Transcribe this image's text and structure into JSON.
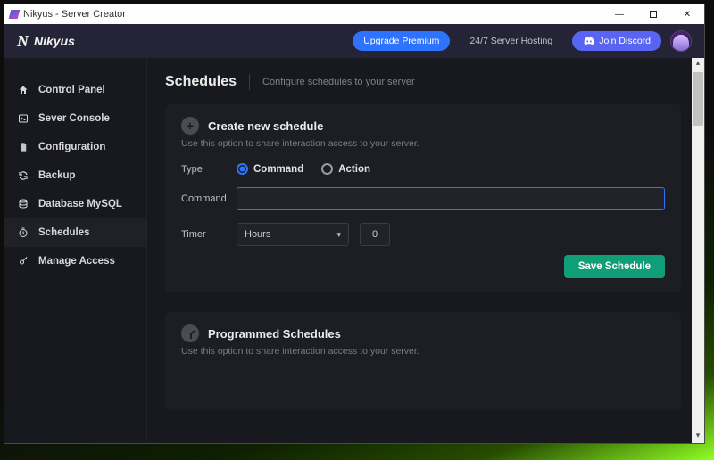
{
  "window": {
    "title": "Nikyus - Server Creator"
  },
  "brand": {
    "name": "Nikyus"
  },
  "header": {
    "upgrade": "Upgrade Premium",
    "hosting": "24/7 Server Hosting",
    "discord": "Join Discord"
  },
  "sidebar": {
    "items": [
      {
        "id": "control-panel",
        "label": "Control Panel",
        "icon": "home-icon"
      },
      {
        "id": "server-console",
        "label": "Sever Console",
        "icon": "console-icon"
      },
      {
        "id": "configuration",
        "label": "Configuration",
        "icon": "file-icon"
      },
      {
        "id": "backup",
        "label": "Backup",
        "icon": "refresh-icon"
      },
      {
        "id": "database",
        "label": "Database MySQL",
        "icon": "database-icon"
      },
      {
        "id": "schedules",
        "label": "Schedules",
        "icon": "clock-icon"
      },
      {
        "id": "manage-access",
        "label": "Manage Access",
        "icon": "key-icon"
      }
    ],
    "active": "schedules"
  },
  "page": {
    "title": "Schedules",
    "subtitle": "Configure schedules to your server"
  },
  "create": {
    "title": "Create new schedule",
    "subtitle": "Use this option to share interaction access to your server.",
    "type_label": "Type",
    "type_options": {
      "command": "Command",
      "action": "Action"
    },
    "type_selected": "command",
    "command_label": "Command",
    "command_value": "",
    "timer_label": "Timer",
    "timer_unit_options": [
      "Hours"
    ],
    "timer_unit_selected": "Hours",
    "timer_value": "0",
    "save_label": "Save Schedule"
  },
  "programmed": {
    "title": "Programmed Schedules",
    "subtitle": "Use this option to share interaction access to your server.",
    "rows": []
  },
  "colors": {
    "accent_blue": "#2e73ff",
    "accent_indigo": "#5865f2",
    "accent_green": "#0f9e78",
    "bg": "#17191e",
    "card": "#1c1e24",
    "header": "#242436"
  }
}
